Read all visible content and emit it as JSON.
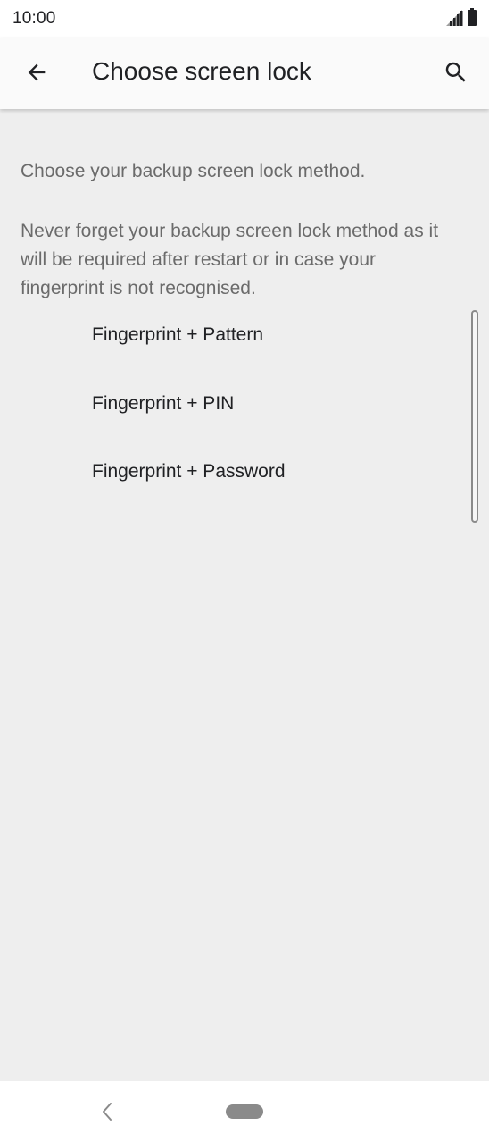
{
  "status_bar": {
    "time": "10:00"
  },
  "app_bar": {
    "title": "Choose screen lock",
    "back_icon": "arrow-back-icon",
    "search_icon": "search-icon"
  },
  "content": {
    "intro": "Choose your backup screen lock method.",
    "warning": "Never forget your backup screen lock method as it will be required after restart or in case your fingerprint is not recognised.",
    "options": [
      {
        "label": "Fingerprint + Pattern"
      },
      {
        "label": "Fingerprint + PIN"
      },
      {
        "label": "Fingerprint + Password"
      }
    ]
  },
  "nav_bar": {
    "back_icon": "chevron-left-icon",
    "home_icon": "home-pill-icon"
  },
  "colors": {
    "background": "#eeeeee",
    "app_bar": "#fafafa",
    "primary_text": "#202124",
    "secondary_text": "#6b6b6b"
  }
}
